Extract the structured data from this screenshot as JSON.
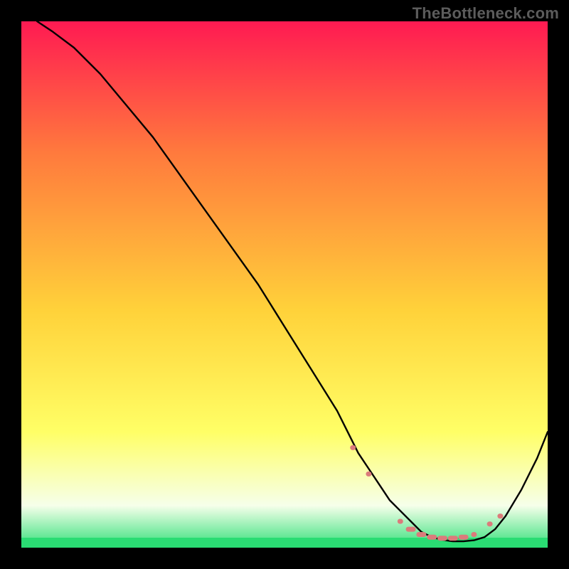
{
  "watermark": "TheBottleneck.com",
  "colors": {
    "gradient_top": "#ff1a52",
    "gradient_mid1": "#ff7a3d",
    "gradient_mid2": "#ffd23a",
    "gradient_mid3": "#ffff66",
    "gradient_bottom_pale": "#f6ffea",
    "gradient_bottom_green": "#33e07a",
    "curve": "#000000",
    "marker": "#db7b7b",
    "frame": "#000000"
  },
  "chart_data": {
    "type": "line",
    "title": "",
    "xlabel": "",
    "ylabel": "",
    "xlim": [
      0,
      100
    ],
    "ylim": [
      0,
      100
    ],
    "x": [
      3,
      6,
      10,
      15,
      20,
      25,
      30,
      35,
      40,
      45,
      50,
      55,
      60,
      62,
      64,
      66,
      68,
      70,
      72,
      74,
      76,
      78,
      80,
      82,
      84,
      86,
      88,
      90,
      92,
      95,
      98,
      100
    ],
    "values": [
      100,
      98,
      95,
      90,
      84,
      78,
      71,
      64,
      57,
      50,
      42,
      34,
      26,
      22,
      18,
      15,
      12,
      9,
      7,
      5,
      3,
      2,
      1.5,
      1.2,
      1.2,
      1.4,
      2,
      3.5,
      6,
      11,
      17,
      22
    ],
    "markers_x": [
      63,
      66,
      72,
      74,
      76,
      78,
      80,
      82,
      84,
      86,
      89,
      91
    ],
    "markers_y": [
      19,
      14,
      5,
      3.5,
      2.5,
      2,
      1.8,
      1.8,
      2,
      2.5,
      4.5,
      6
    ],
    "note": "x and y are 0–100 relative to the plot area; curve is a bottleneck/V profile with minimum near x≈82"
  }
}
